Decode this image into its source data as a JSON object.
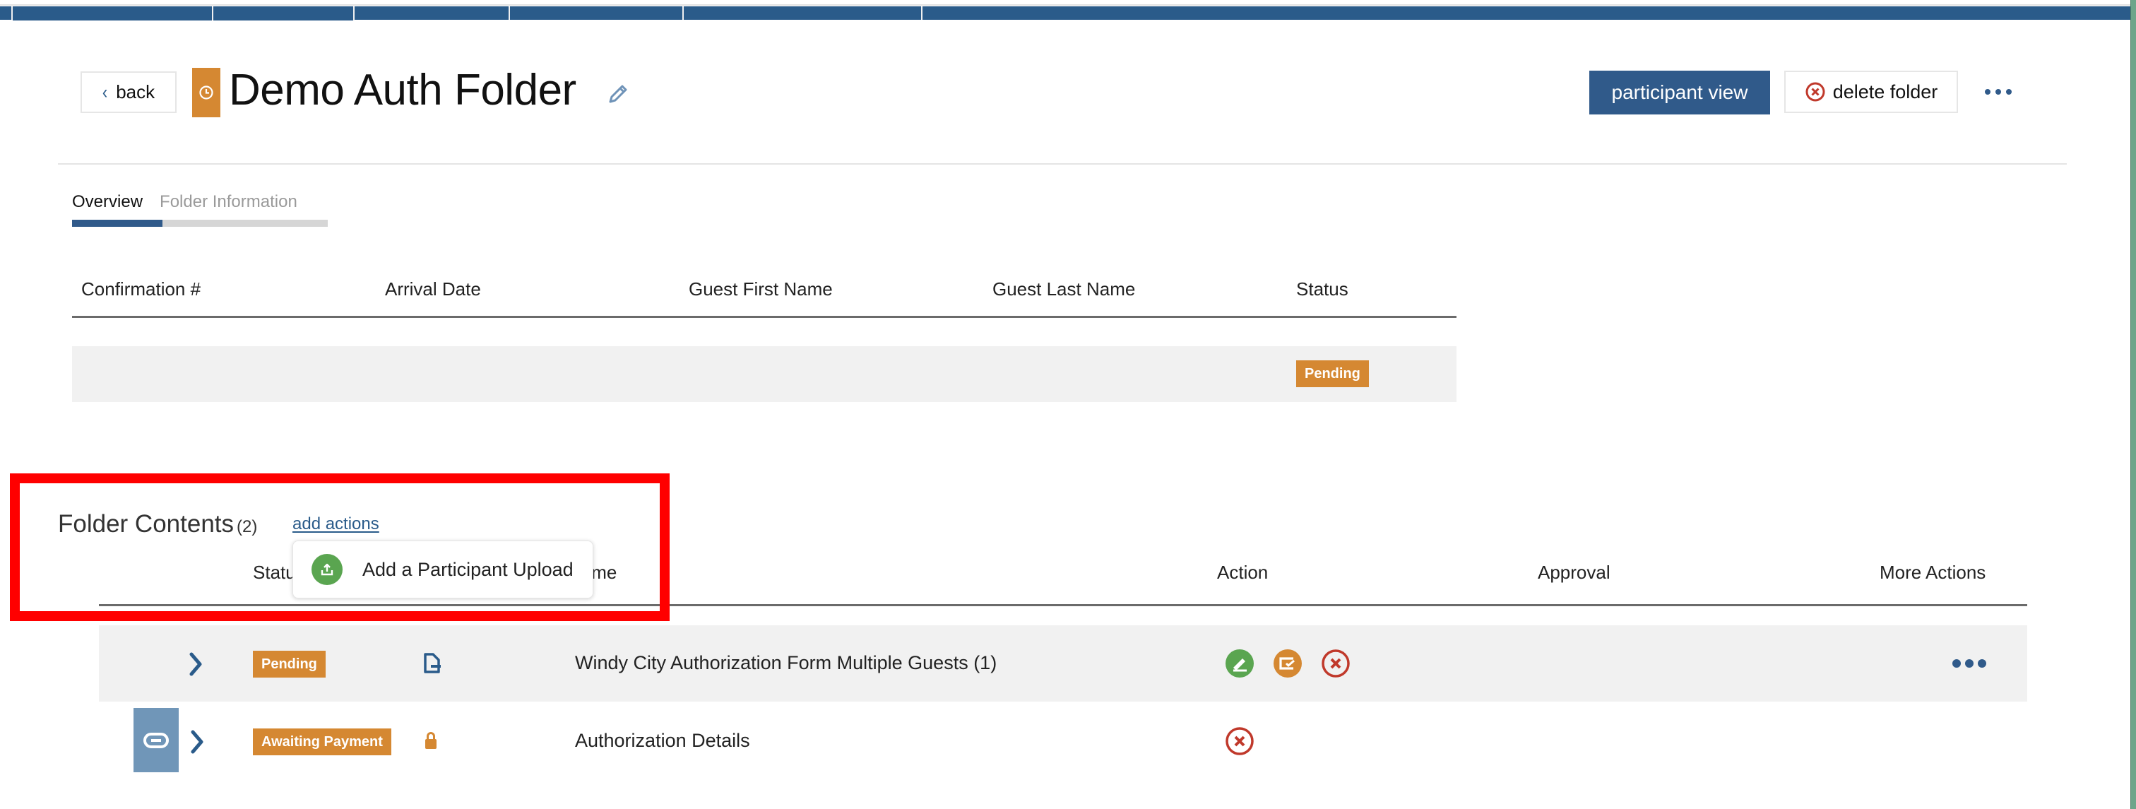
{
  "topnav": {
    "segments": 7
  },
  "header": {
    "back_label": "back",
    "title": "Demo Auth Folder",
    "participant_view_label": "participant view",
    "delete_folder_label": "delete folder",
    "more_menu_icon": "ellipsis-icon",
    "status_icon": "clock-icon",
    "edit_icon": "pencil-icon"
  },
  "tabs": [
    {
      "label": "Overview",
      "active": true
    },
    {
      "label": "Folder Information",
      "active": false
    }
  ],
  "overview_table": {
    "columns": [
      "Confirmation #",
      "Arrival Date",
      "Guest First Name",
      "Guest Last Name",
      "Status"
    ],
    "rows": [
      {
        "confirmation": "",
        "arrival_date": "",
        "guest_first_name": "",
        "guest_last_name": "",
        "status": "Pending"
      }
    ]
  },
  "folder_contents": {
    "title": "Folder Contents",
    "count": "(2)",
    "add_actions_label": "add actions",
    "dropdown": {
      "items": [
        {
          "label": "Add a Participant Upload",
          "icon": "upload-icon"
        }
      ]
    },
    "columns": [
      "Status",
      "Name",
      "Action",
      "Approval",
      "More Actions"
    ],
    "rows": [
      {
        "status": "Pending",
        "type_icon": "document-icon",
        "name": "Windy City Authorization Form Multiple Guests (1)",
        "actions": [
          "sign-icon",
          "review-icon",
          "cancel-icon"
        ],
        "approval": "",
        "has_more_actions": true
      },
      {
        "status": "Awaiting Payment",
        "type_icon": "lock-icon",
        "name": "Authorization Details",
        "actions": [
          "cancel-icon"
        ],
        "approval": "",
        "linked": true
      }
    ]
  },
  "colors": {
    "brand_blue": "#305a8a",
    "status_orange": "#d58832",
    "success_green": "#5aa550",
    "danger_red": "#c0392b",
    "highlight_red": "#ff0000"
  }
}
